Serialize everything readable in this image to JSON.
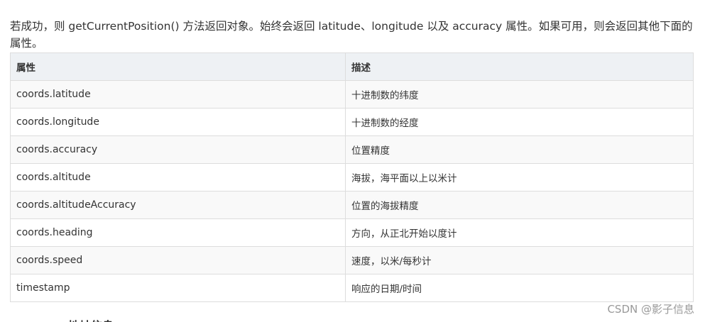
{
  "intro": {
    "text": "若成功，则 getCurrentPosition() 方法返回对象。始终会返回 latitude、longitude 以及 accuracy 属性。如果可用，则会返回其他下面的属性。"
  },
  "table": {
    "headers": {
      "property": "属性",
      "description": "描述"
    },
    "rows": [
      {
        "property": "coords.latitude",
        "description": "十进制数的纬度"
      },
      {
        "property": "coords.longitude",
        "description": "十进制数的经度"
      },
      {
        "property": "coords.accuracy",
        "description": "位置精度"
      },
      {
        "property": "coords.altitude",
        "description": "海拔，海平面以上以米计"
      },
      {
        "property": "coords.altitudeAccuracy",
        "description": "位置的海拔精度"
      },
      {
        "property": "coords.heading",
        "description": "方向，从正北开始以度计"
      },
      {
        "property": "coords.speed",
        "description": "速度，以米/每秒计"
      },
      {
        "property": "timestamp",
        "description": "响应的日期/时间"
      }
    ]
  },
  "next_heading_partial": "地址信息",
  "watermark": "CSDN @影子信息"
}
